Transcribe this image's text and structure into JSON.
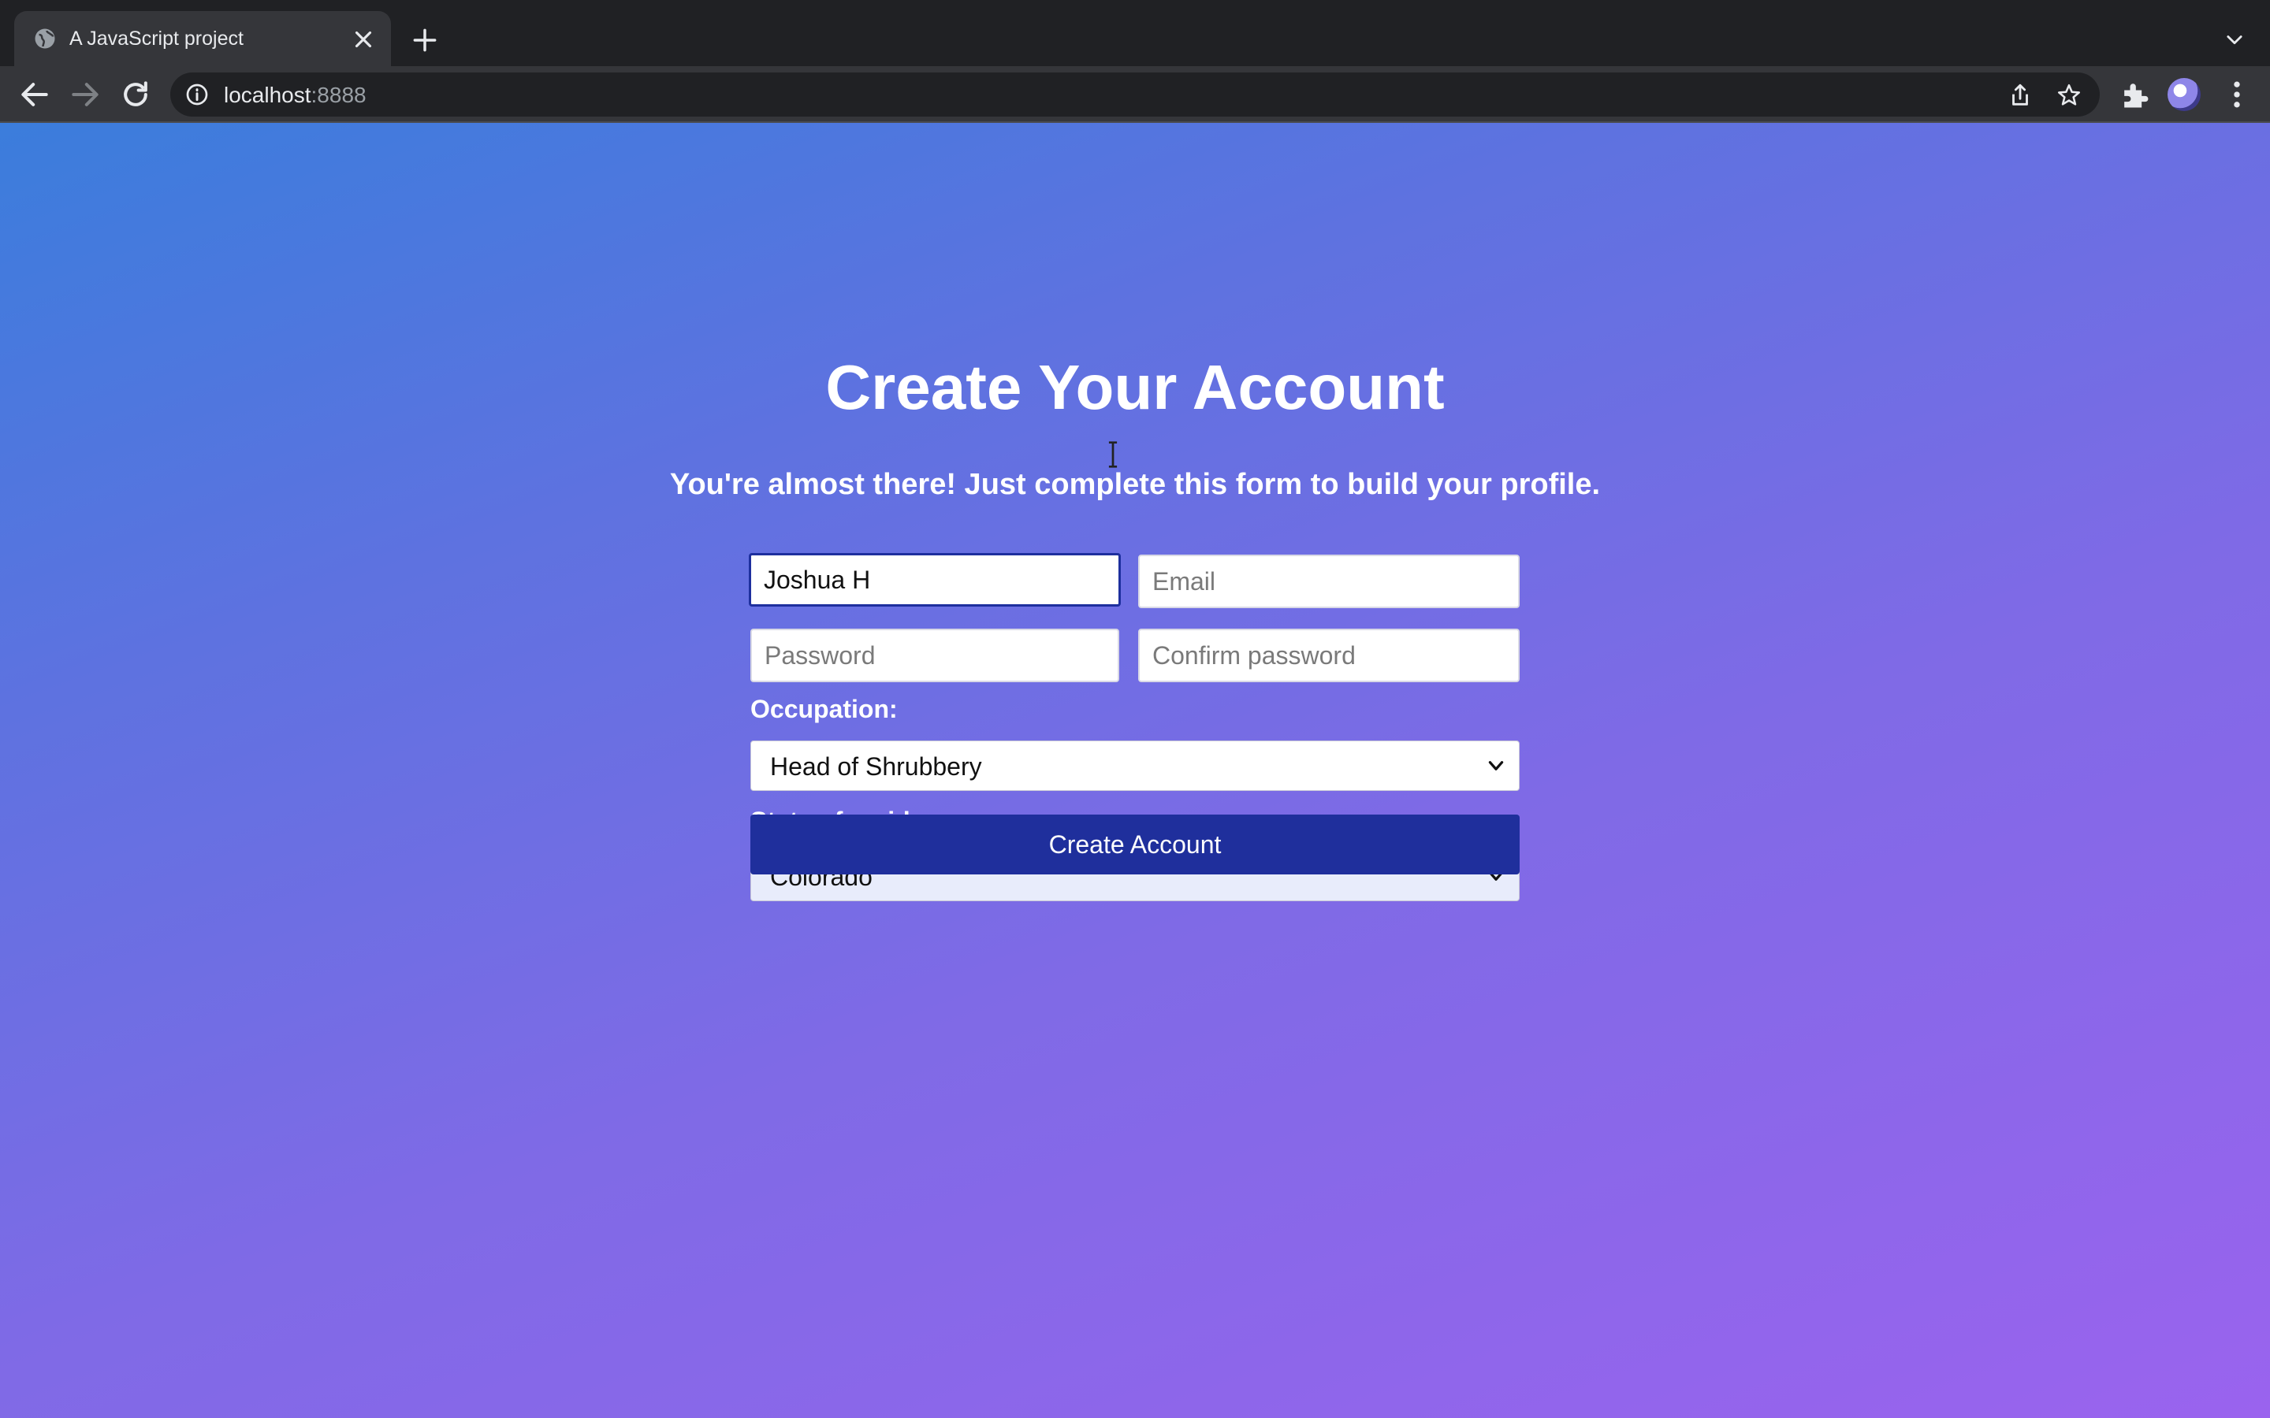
{
  "browser": {
    "tab_title": "A JavaScript project",
    "url_host": "localhost",
    "url_port": ":8888"
  },
  "page": {
    "heading": "Create Your Account",
    "subheading": "You're almost there! Just complete this form to build your profile."
  },
  "form": {
    "name_value": "Joshua H",
    "email_placeholder": "Email",
    "password_placeholder": "Password",
    "confirm_placeholder": "Confirm password",
    "occupation_label": "Occupation:",
    "occupation_value": "Head of Shrubbery",
    "state_label": "State of residence:",
    "state_value": "Colorado",
    "submit_label": "Create Account"
  }
}
